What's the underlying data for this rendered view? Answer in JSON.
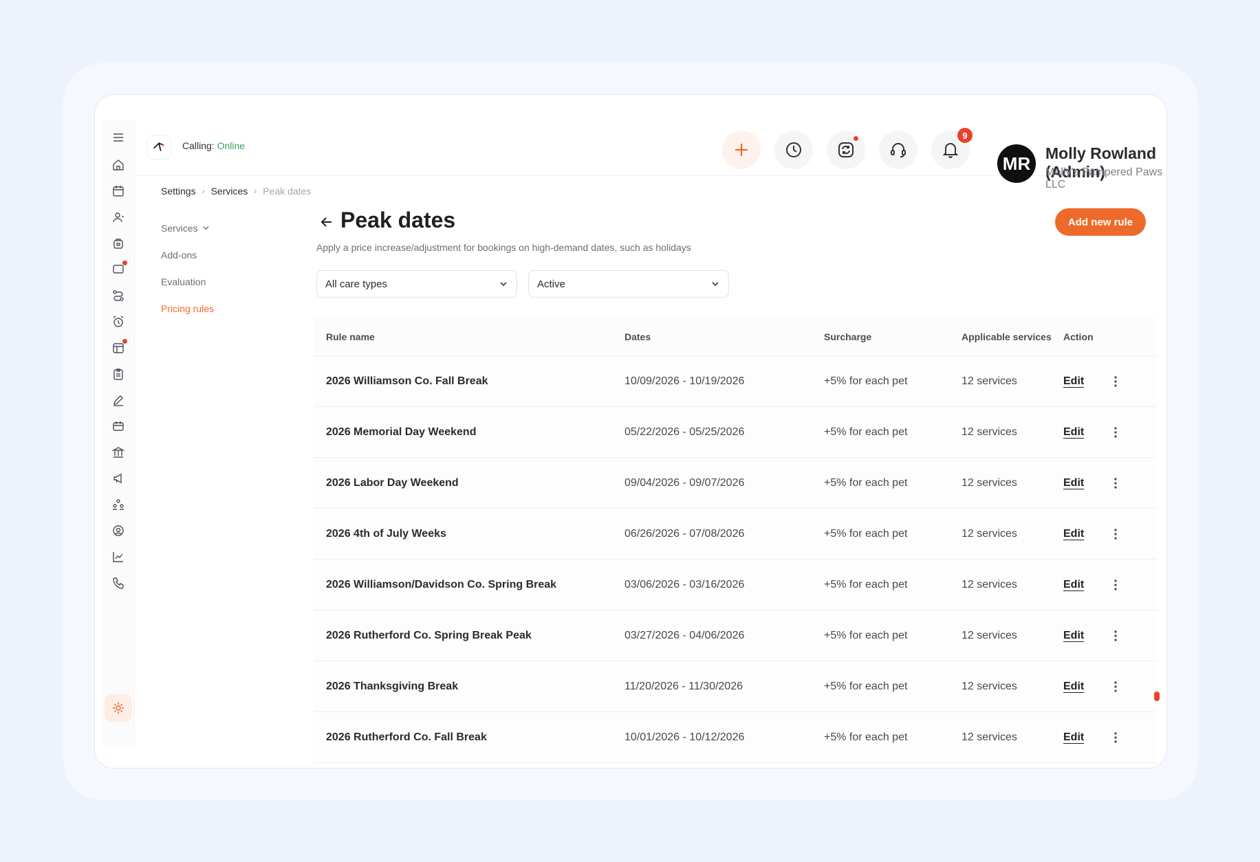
{
  "header": {
    "calling_label": "Calling:",
    "calling_status": "Online",
    "notification_count": "9",
    "user": {
      "initials": "MR",
      "name": "Molly Rowland (Admin)",
      "org": "Molly's Pampered Paws LLC"
    }
  },
  "breadcrumb": [
    "Settings",
    "Services",
    "Peak dates"
  ],
  "submenu": {
    "services": "Services",
    "addons": "Add-ons",
    "evaluation": "Evaluation",
    "pricing_rules": "Pricing rules"
  },
  "page": {
    "title": "Peak dates",
    "subtitle": "Apply a price increase/adjustment for bookings on high-demand dates, such as holidays",
    "add_button": "Add new rule"
  },
  "filters": {
    "care_type": "All care types",
    "status": "Active"
  },
  "table": {
    "headers": {
      "rule_name": "Rule name",
      "dates": "Dates",
      "surcharge": "Surcharge",
      "applicable_services": "Applicable services",
      "action": "Action"
    },
    "rows": [
      {
        "name": "2026 Williamson Co. Fall Break",
        "dates": "10/09/2026 - 10/19/2026",
        "surcharge": "+5% for each pet",
        "services": "12 services",
        "action": "Edit"
      },
      {
        "name": "2026 Memorial Day Weekend",
        "dates": "05/22/2026 - 05/25/2026",
        "surcharge": "+5% for each pet",
        "services": "12 services",
        "action": "Edit"
      },
      {
        "name": "2026 Labor Day Weekend",
        "dates": "09/04/2026 - 09/07/2026",
        "surcharge": "+5% for each pet",
        "services": "12 services",
        "action": "Edit"
      },
      {
        "name": "2026 4th of July Weeks",
        "dates": "06/26/2026 - 07/08/2026",
        "surcharge": "+5% for each pet",
        "services": "12 services",
        "action": "Edit"
      },
      {
        "name": "2026 Williamson/Davidson Co. Spring Break",
        "dates": "03/06/2026 - 03/16/2026",
        "surcharge": "+5% for each pet",
        "services": "12 services",
        "action": "Edit"
      },
      {
        "name": "2026 Rutherford Co. Spring Break Peak",
        "dates": "03/27/2026 - 04/06/2026",
        "surcharge": "+5% for each pet",
        "services": "12 services",
        "action": "Edit"
      },
      {
        "name": "2026 Thanksgiving Break",
        "dates": "11/20/2026 - 11/30/2026",
        "surcharge": "+5% for each pet",
        "services": "12 services",
        "action": "Edit"
      },
      {
        "name": "2026 Rutherford Co. Fall Break",
        "dates": "10/01/2026 - 10/12/2026",
        "surcharge": "+5% for each pet",
        "services": "12 services",
        "action": "Edit"
      }
    ]
  },
  "colors": {
    "accent": "#ee6a2b",
    "online": "#3fa25a",
    "badge": "#e8412c"
  }
}
